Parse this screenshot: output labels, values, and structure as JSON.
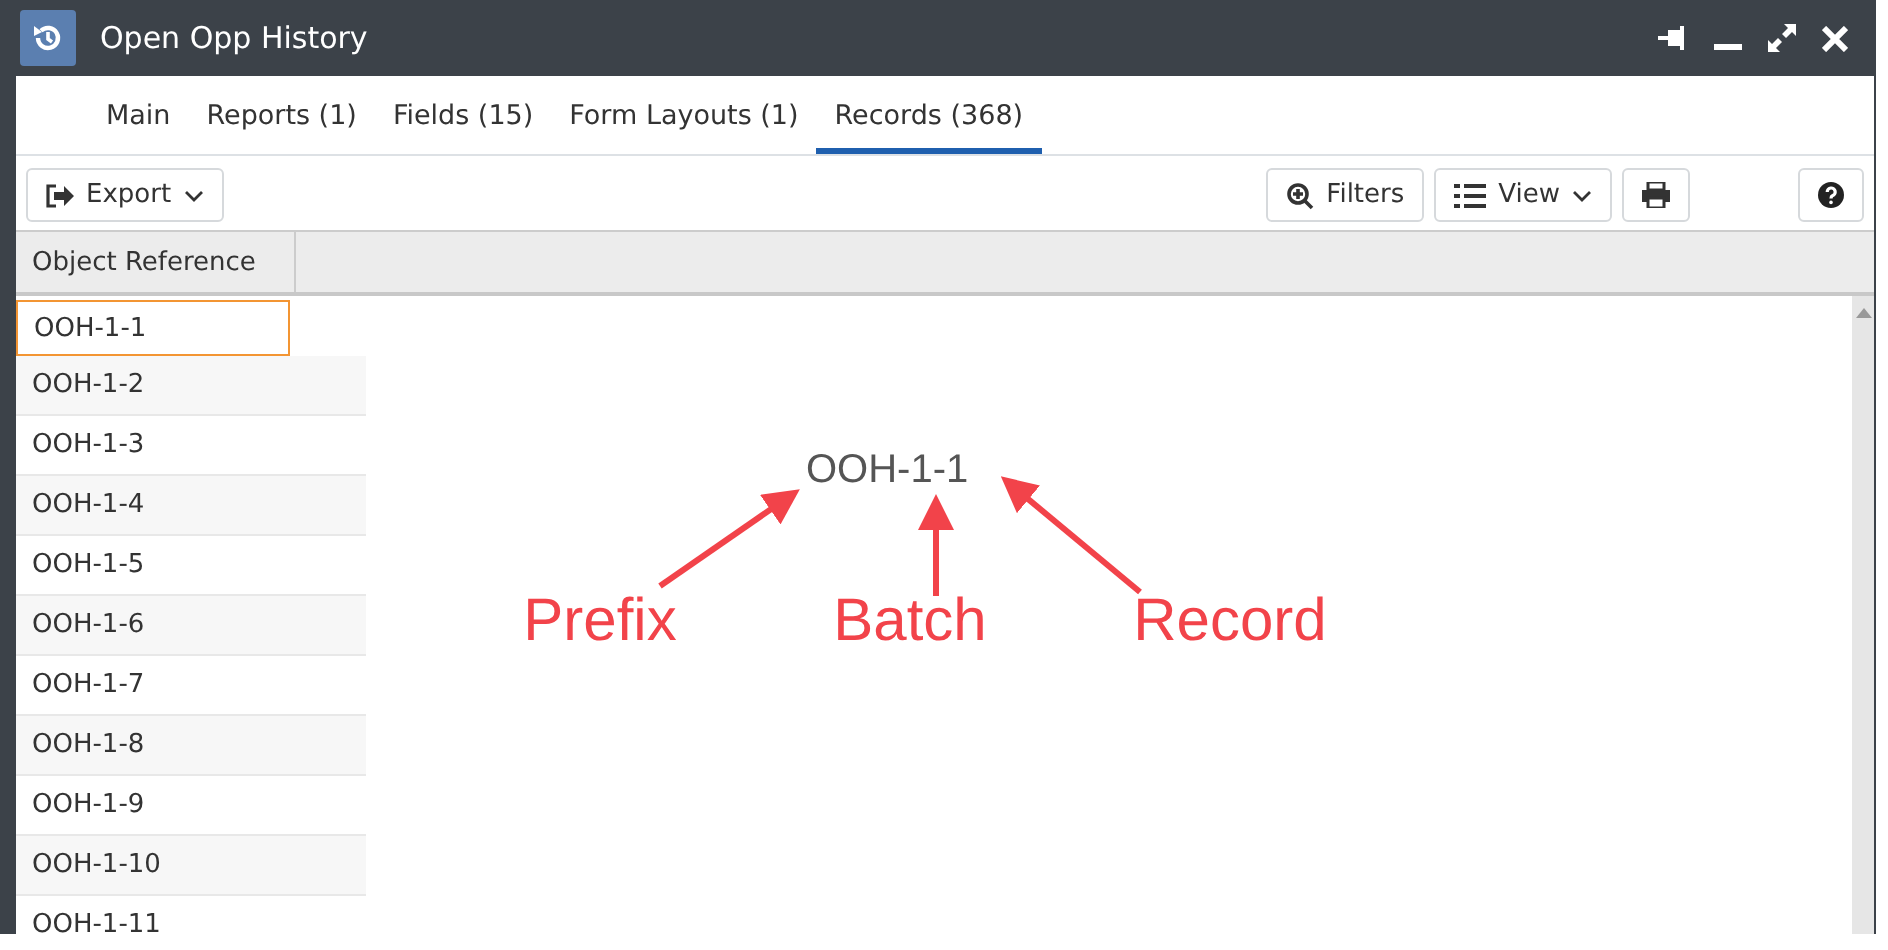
{
  "window": {
    "title": "Open Opp History"
  },
  "tabs": [
    {
      "label": "Main",
      "selected": false
    },
    {
      "label": "Reports (1)",
      "selected": false
    },
    {
      "label": "Fields (15)",
      "selected": false
    },
    {
      "label": "Form Layouts (1)",
      "selected": false
    },
    {
      "label": "Records (368)",
      "selected": true
    }
  ],
  "toolbar": {
    "export": "Export",
    "filters": "Filters",
    "view": "View"
  },
  "table": {
    "columns": [
      "Object Reference"
    ],
    "rows": [
      {
        "cell": "OOH-1-1",
        "selected": true
      },
      {
        "cell": "OOH-1-2",
        "selected": false
      },
      {
        "cell": "OOH-1-3",
        "selected": false
      },
      {
        "cell": "OOH-1-4",
        "selected": false
      },
      {
        "cell": "OOH-1-5",
        "selected": false
      },
      {
        "cell": "OOH-1-6",
        "selected": false
      },
      {
        "cell": "OOH-1-7",
        "selected": false
      },
      {
        "cell": "OOH-1-8",
        "selected": false
      },
      {
        "cell": "OOH-1-9",
        "selected": false
      },
      {
        "cell": "OOH-1-10",
        "selected": false
      },
      {
        "cell": "OOH-1-11",
        "selected": false
      }
    ]
  },
  "annotation": {
    "sample": "OOH-1-1",
    "labels": [
      "Prefix",
      "Batch",
      "Record"
    ]
  }
}
